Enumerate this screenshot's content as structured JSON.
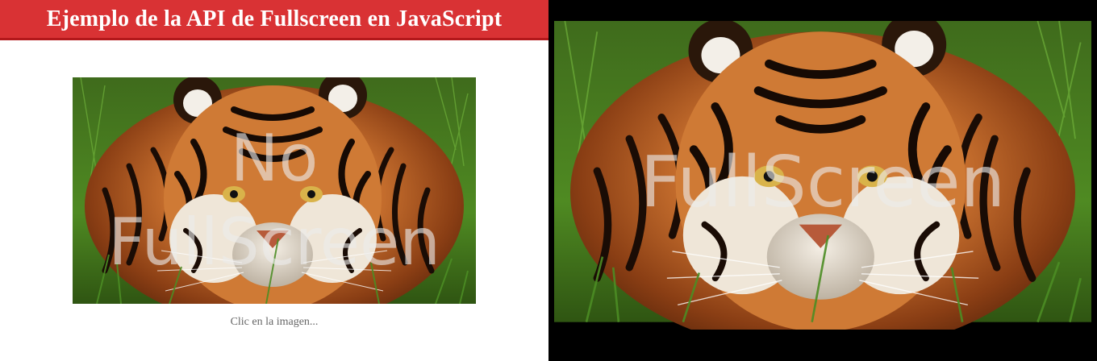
{
  "header": {
    "title": "Ejemplo de la API de Fullscreen en JavaScript"
  },
  "normal_view": {
    "overlay_line1": "No",
    "overlay_line2": "FullScreen",
    "caption": "Clic en la imagen...",
    "image_subject": "tiger-photo"
  },
  "fullscreen_view": {
    "overlay_text": "FullScreen",
    "image_subject": "tiger-photo"
  },
  "colors": {
    "header_bg": "#d93234",
    "header_border": "#b3181b",
    "fullscreen_bg": "#000000",
    "caption_text": "#666666"
  }
}
